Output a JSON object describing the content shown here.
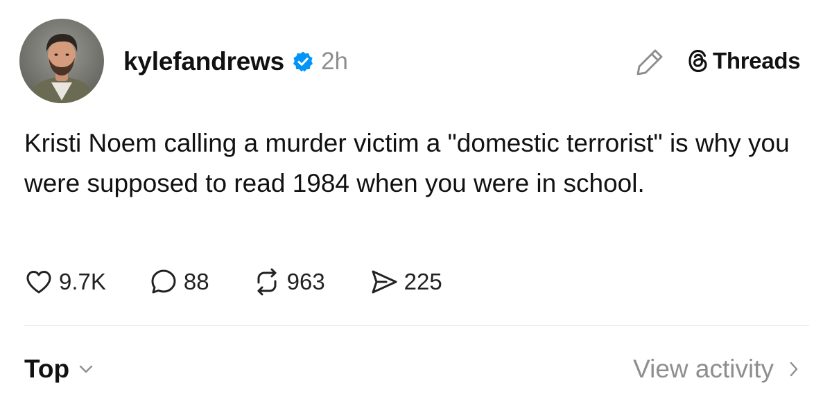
{
  "post": {
    "author": {
      "username": "kylefandrews",
      "verified": true,
      "avatar_icon": "profile-photo"
    },
    "time_ago": "2h",
    "text": "Kristi Noem calling a murder victim a \"domestic terrorist\" is why you were supposed to read 1984 when you were in school.",
    "stats": {
      "likes": "9.7K",
      "replies": "88",
      "reposts": "963",
      "shares": "225"
    }
  },
  "header": {
    "edit_icon": "pencil-icon",
    "brand_label": "Threads",
    "brand_icon": "threads-logo-icon"
  },
  "footer": {
    "sort_label": "Top",
    "view_activity_label": "View activity"
  },
  "colors": {
    "text": "#111111",
    "muted": "#8e8e8e",
    "verified_blue": "#0095f6",
    "divider": "#dcdcdc"
  }
}
